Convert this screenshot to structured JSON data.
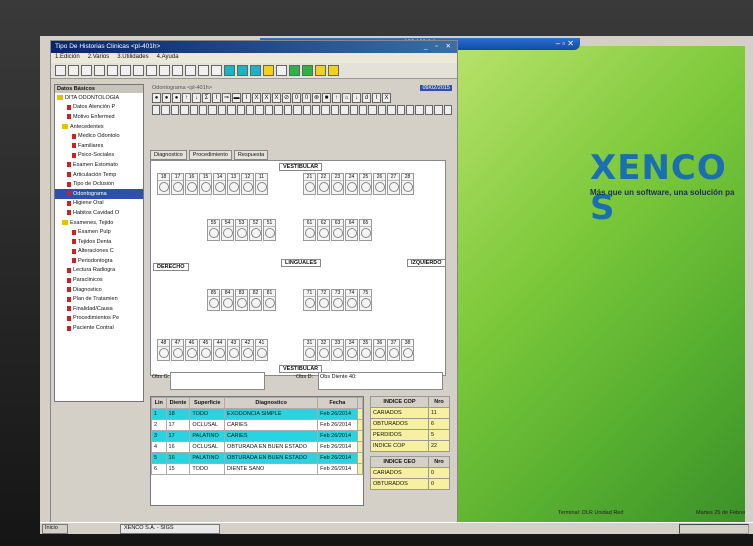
{
  "remote_bar": {
    "title": "192.168.0.1"
  },
  "window": {
    "title": "Tipo De Historias Clinicas <pl-401h>"
  },
  "menu": [
    "1.Edición",
    "2.Varios",
    "3.Utilidades",
    "4.Ayuda"
  ],
  "tree": {
    "header": "Datos Básicos",
    "items": [
      {
        "label": "DITA ODONTOLOGIA",
        "kind": "folder",
        "indent": 0
      },
      {
        "label": "Datos Atención P",
        "kind": "leaf",
        "indent": 2
      },
      {
        "label": "Motivo Enfermed",
        "kind": "leaf",
        "indent": 2
      },
      {
        "label": "Antecedentes",
        "kind": "folder",
        "indent": 1
      },
      {
        "label": "Medico Odontolo",
        "kind": "leaf",
        "indent": 3
      },
      {
        "label": "Familiares",
        "kind": "leaf",
        "indent": 3
      },
      {
        "label": "Psico-Sociales",
        "kind": "leaf",
        "indent": 3
      },
      {
        "label": "Examen Estomato",
        "kind": "leaf",
        "indent": 2
      },
      {
        "label": "Articulación Temp",
        "kind": "leaf",
        "indent": 2
      },
      {
        "label": "Tipo de Oclusion",
        "kind": "leaf",
        "indent": 2
      },
      {
        "label": "Odontograma",
        "kind": "leaf",
        "indent": 2,
        "selected": true
      },
      {
        "label": "Higiene Oral",
        "kind": "leaf",
        "indent": 2
      },
      {
        "label": "Habitos Cavidad O",
        "kind": "leaf",
        "indent": 2
      },
      {
        "label": "Examenes, Tejido",
        "kind": "folder",
        "indent": 1
      },
      {
        "label": "Examen Pulp",
        "kind": "leaf",
        "indent": 3
      },
      {
        "label": "Tejidos Denta",
        "kind": "leaf",
        "indent": 3
      },
      {
        "label": "Alteraciones C",
        "kind": "leaf",
        "indent": 3
      },
      {
        "label": "Periodontogra",
        "kind": "leaf",
        "indent": 3
      },
      {
        "label": "Lectura Radiogra",
        "kind": "leaf",
        "indent": 2
      },
      {
        "label": "Paraclinicos",
        "kind": "leaf",
        "indent": 2
      },
      {
        "label": "Diagnostico",
        "kind": "leaf",
        "indent": 2
      },
      {
        "label": "Plan de Tratamien",
        "kind": "leaf",
        "indent": 2
      },
      {
        "label": "Finalidad/Causa",
        "kind": "leaf",
        "indent": 2
      },
      {
        "label": "Procedimientos Pe",
        "kind": "leaf",
        "indent": 2
      },
      {
        "label": "Paciente Contral",
        "kind": "leaf",
        "indent": 2
      }
    ]
  },
  "odontogram": {
    "header": "Odontograma <pl-401h>",
    "date": "09/02/2015",
    "symbols_row1": [
      "●",
      "●",
      "●",
      "↑",
      "↓",
      "Σ",
      "I",
      "⇒",
      "▬",
      "I",
      "X",
      "X",
      "X",
      "⊘",
      "0",
      "0",
      "⊗",
      "■",
      "↑",
      "⌂",
      "↓",
      "d",
      "I",
      "X"
    ],
    "tabs": [
      "Diagnostico",
      "Procedimiento",
      "Respuesta"
    ],
    "labels": {
      "vestibular": "VESTIBULAR",
      "linguales": "LINGUALES",
      "derecho": "DERECHO",
      "izquierdo": "IZQUIERDO"
    },
    "row_top_right": [
      "18",
      "17",
      "16",
      "15",
      "14",
      "13",
      "12",
      "11"
    ],
    "row_top_left": [
      "21",
      "22",
      "23",
      "24",
      "25",
      "26",
      "27",
      "28"
    ],
    "row_temp_upper_right": [
      "55",
      "54",
      "53",
      "52",
      "51"
    ],
    "row_temp_upper_left": [
      "61",
      "62",
      "63",
      "64",
      "65"
    ],
    "row_temp_lower_right": [
      "85",
      "84",
      "83",
      "82",
      "81"
    ],
    "row_temp_lower_left": [
      "71",
      "72",
      "73",
      "74",
      "75"
    ],
    "row_bottom_right": [
      "48",
      "47",
      "46",
      "45",
      "44",
      "43",
      "42",
      "41"
    ],
    "row_bottom_left": [
      "31",
      "32",
      "33",
      "34",
      "35",
      "36",
      "37",
      "38"
    ],
    "obs_g_label": "Obs G:",
    "obs_d_label": "Obs D:",
    "obs_d_value": "Obs Diente 40:"
  },
  "diagnoses_grid": {
    "columns": [
      "Lin",
      "Diente",
      "Superficie",
      "Diagnostico",
      "Fecha",
      ""
    ],
    "rows": [
      {
        "lin": "1",
        "diente": "18",
        "sup": "TODO",
        "diag": "EXODONCIA SIMPLE",
        "fecha": "Feb 26/2014",
        "hl": true
      },
      {
        "lin": "2",
        "diente": "17",
        "sup": "OCLUSAL",
        "diag": "CARIES",
        "fecha": "Feb 26/2014",
        "hl": false
      },
      {
        "lin": "3",
        "diente": "17",
        "sup": "PALATINO",
        "diag": "CARIES",
        "fecha": "Feb 26/2014",
        "hl": true
      },
      {
        "lin": "4",
        "diente": "16",
        "sup": "OCLUSAL",
        "diag": "OBTURADA EN BUEN ESTADO",
        "fecha": "Feb 26/2014",
        "hl": false
      },
      {
        "lin": "5",
        "diente": "16",
        "sup": "PALATINO",
        "diag": "OBTURADA EN BUEN ESTADO",
        "fecha": "Feb 26/2014",
        "hl": true
      },
      {
        "lin": "6",
        "diente": "15",
        "sup": "TODO",
        "diag": "DIENTE SANO",
        "fecha": "Feb 26/2014",
        "hl": false
      }
    ]
  },
  "index_cop": {
    "title": "INDICE COP",
    "nro": "Nro",
    "rows": [
      {
        "label": "CARIADOS",
        "val": "11"
      },
      {
        "label": "OBTURADOS",
        "val": "6"
      },
      {
        "label": "PERDIDOS",
        "val": "5"
      },
      {
        "label": "INDICE COP",
        "val": "22"
      }
    ]
  },
  "index_ceo": {
    "title": "INDICE CEO",
    "nro": "Nro",
    "rows": [
      {
        "label": "CARIADOS",
        "val": "0"
      },
      {
        "label": "OBTURADOS",
        "val": "0"
      }
    ]
  },
  "brand": {
    "logo": "XENCO S",
    "slogan": "Más que un software, una solución pa"
  },
  "status": {
    "left": "Terminal: DLR Unidad Red",
    "right": "Martes 25 de Febrer"
  },
  "taskbar": {
    "start": "Inicio",
    "task": "XENCO S.A. - SIGS"
  }
}
